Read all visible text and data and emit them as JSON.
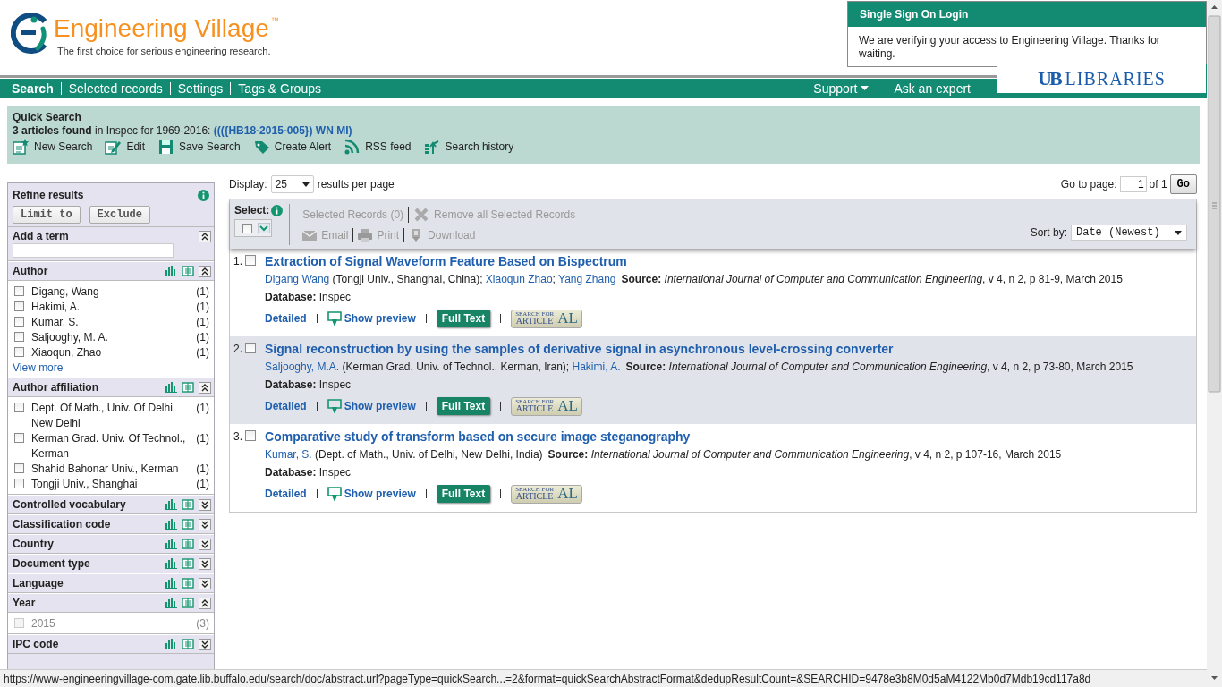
{
  "header": {
    "logo_text": "Engineering Village",
    "trademark": "™",
    "tagline": "The first choice for serious engineering research."
  },
  "sso_popup": {
    "title": "Single Sign On Login",
    "message": "We are verifying your access to Engineering Village. Thanks for waiting."
  },
  "library_logo": {
    "monogram": "UB",
    "text": "LIBRARIES"
  },
  "nav": {
    "items": [
      {
        "label": "Search",
        "selected": true
      },
      {
        "label": "Selected records",
        "selected": false
      },
      {
        "label": "Settings",
        "selected": false
      },
      {
        "label": "Tags & Groups",
        "selected": false
      }
    ],
    "right": [
      {
        "label": "Support",
        "kind": "dropdown"
      },
      {
        "label": "Ask an expert",
        "kind": "link"
      }
    ]
  },
  "quick_search": {
    "title": "Quick Search",
    "summary": "**3 articles found** in Inspec for 1969-2016: ",
    "query": "((({HB18-2015-005}) WN MI)",
    "actions": [
      "New Search",
      "Edit",
      "Save Search",
      "Create Alert",
      "RSS feed",
      "Search history"
    ]
  },
  "sidebar": {
    "title": "Refine results",
    "buttons": [
      "Limit to",
      "Exclude"
    ],
    "add_term": {
      "label": "Add a term",
      "expanded": true
    },
    "facets": [
      {
        "label": "Author",
        "expanded": true,
        "items": [
          {
            "label": "Digang, Wang",
            "count": "(1)",
            "checked": false,
            "disabled": false
          },
          {
            "label": "Hakimi, A.",
            "count": "(1)",
            "checked": false,
            "disabled": false
          },
          {
            "label": "Kumar, S.",
            "count": "(1)",
            "checked": false,
            "disabled": false
          },
          {
            "label": "Saljooghy, M. A.",
            "count": "(1)",
            "checked": false,
            "disabled": false
          },
          {
            "label": "Xiaoqun, Zhao",
            "count": "(1)",
            "checked": false,
            "disabled": false
          }
        ],
        "more": "View more"
      },
      {
        "label": "Author affiliation",
        "expanded": true,
        "items": [
          {
            "label": "Dept. Of Math., Univ. Of Delhi, New Delhi",
            "count": "(1)",
            "checked": false,
            "disabled": false
          },
          {
            "label": "Kerman Grad. Univ. Of Technol., Kerman",
            "count": "(1)",
            "checked": false,
            "disabled": false
          },
          {
            "label": "Shahid Bahonar Univ., Kerman",
            "count": "(1)",
            "checked": false,
            "disabled": false
          },
          {
            "label": "Tongji Univ., Shanghai",
            "count": "(1)",
            "checked": false,
            "disabled": false
          }
        ]
      },
      {
        "label": "Controlled vocabulary",
        "expanded": false
      },
      {
        "label": "Classification code",
        "expanded": false
      },
      {
        "label": "Country",
        "expanded": false
      },
      {
        "label": "Document type",
        "expanded": false
      },
      {
        "label": "Language",
        "expanded": false
      },
      {
        "label": "Year",
        "expanded": true,
        "items": [
          {
            "label": "2015",
            "count": "(3)",
            "checked": false,
            "disabled": true
          }
        ]
      },
      {
        "label": "IPC code",
        "expanded": false
      }
    ]
  },
  "results": {
    "display": {
      "label": "Display:",
      "value": "25",
      "suffix": "results per page"
    },
    "pagination": {
      "label": "Go to page:",
      "value": "1",
      "of": "of 1",
      "button": "Go"
    },
    "select_bar": {
      "label": "Select:",
      "selected_records": {
        "label": "Selected Records (0)",
        "disabled": true
      },
      "remove_all": {
        "label": "Remove all Selected Records",
        "disabled": true
      },
      "actions": [
        {
          "label": "Email",
          "disabled": true
        },
        {
          "label": "Print",
          "disabled": true
        },
        {
          "label": "Download",
          "disabled": true
        }
      ],
      "sort_label": "Sort by:",
      "sort_value": "Date (Newest)"
    },
    "records": [
      {
        "number": "1.",
        "checked": false,
        "highlighted": false,
        "title": "Extraction of Signal Waveform Feature Based on Bispectrum",
        "authors": [
          {
            "text": "Digang Wang",
            "kind": "link"
          },
          {
            "text": " (Tongji Univ., Shanghai, China); ",
            "kind": "plain"
          },
          {
            "text": "Xiaoqun Zhao",
            "kind": "link"
          },
          {
            "text": "; ",
            "kind": "plain"
          },
          {
            "text": "Yang Zhang",
            "kind": "link"
          }
        ],
        "source_label": "Source:",
        "source": "*International Journal of Computer and Communication Engineering*, v 4, n 2, p 81-9, March 2015",
        "database_label": "Database:",
        "database": "Inspec",
        "detailed": "Detailed",
        "preview": "Show preview",
        "full_text": "Full Text",
        "linker": {
          "line1": "SEARCH FOR",
          "line2": "ARTICLE",
          "mark": "AL"
        }
      },
      {
        "number": "2.",
        "checked": false,
        "highlighted": true,
        "title": "Signal reconstruction by using the samples of derivative signal in asynchronous level-crossing converter",
        "authors": [
          {
            "text": "Saljooghy, M.A.",
            "kind": "link"
          },
          {
            "text": " (Kerman Grad. Univ. of Technol., Kerman, Iran); ",
            "kind": "plain"
          },
          {
            "text": "Hakimi, A.",
            "kind": "link"
          }
        ],
        "source_label": "Source:",
        "source": "*International Journal of Computer and Communication Engineering*, v 4, n 2, p 73-80, March 2015",
        "database_label": "Database:",
        "database": "Inspec",
        "detailed": "Detailed",
        "preview": "Show preview",
        "full_text": "Full Text",
        "linker": {
          "line1": "SEARCH FOR",
          "line2": "ARTICLE",
          "mark": "AL"
        }
      },
      {
        "number": "3.",
        "checked": false,
        "highlighted": false,
        "title": "Comparative study of transform based on secure image steganography",
        "authors": [
          {
            "text": "Kumar, S.",
            "kind": "link"
          },
          {
            "text": " (Dept. of Math., Univ. of Delhi, New Delhi, India)",
            "kind": "plain"
          }
        ],
        "source_label": "Source:",
        "source": "*International Journal of Computer and Communication Engineering*, v 4, n 2, p 107-16, March 2015",
        "database_label": "Database:",
        "database": "Inspec",
        "detailed": "Detailed",
        "preview": "Show preview",
        "full_text": "Full Text",
        "linker": {
          "line1": "SEARCH FOR",
          "line2": "ARTICLE",
          "mark": "AL"
        }
      }
    ]
  },
  "status_bar": {
    "url": "https://www-engineeringvillage-com.gate.lib.buffalo.edu/search/doc/abstract.url?pageType=quickSearch...=2&format=quickSearchAbstractFormat&dedupResultCount=&SEARCHID=9478e3b8M0d5aM4122Mb0d7Mdb19cd117a8d"
  }
}
